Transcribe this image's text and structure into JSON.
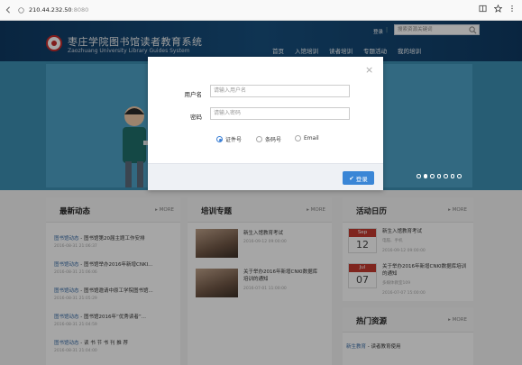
{
  "browser": {
    "address_host": "210.44.232.50",
    "address_port": ":8080"
  },
  "site": {
    "title": "枣庄学院图书馆读者教育系统",
    "subtitle": "Zaozhuang University Library Guides System",
    "login_link": "登录",
    "search_placeholder": "搜索资源关键词",
    "nav": [
      "首页",
      "入馆培训",
      "读者培训",
      "专题活动",
      "我的培训"
    ]
  },
  "modal": {
    "username_label": "用户名",
    "username_placeholder": "请输入用户名",
    "password_label": "密码",
    "password_placeholder": "请输入密码",
    "options": [
      {
        "label": "证件号",
        "checked": true
      },
      {
        "label": "条码号",
        "checked": false
      },
      {
        "label": "Email",
        "checked": false
      }
    ],
    "login_button": "登录"
  },
  "news": {
    "title": "最新动态",
    "more": "MORE",
    "items": [
      {
        "tag": "图书馆动态",
        "text": " - 图书馆第20届主题工作安排",
        "date": "2016-08-31 21:06:37"
      },
      {
        "tag": "图书馆动态",
        "text": " - 图书馆举办2016年新增CNKI...",
        "date": "2016-08-31 21:06:06"
      },
      {
        "tag": "图书馆动态",
        "text": " - 图书馆邀请中原工学院图书馆...",
        "date": "2016-08-31 21:05:29"
      },
      {
        "tag": "图书馆动态",
        "text": " - 图书馆2016年“优秀读者”...",
        "date": "2016-08-31 21:04:59"
      },
      {
        "tag": "图书馆动态",
        "text": " - 读 书 节 书 刊 推 荐",
        "date": "2016-08-31 21:04:00"
      }
    ]
  },
  "training": {
    "title": "培训专题",
    "more": "MORE",
    "items": [
      {
        "text": "新生入馆教育考试",
        "date": "2016-09-12 09:00:00"
      },
      {
        "text": "关于举办2016年新增CNKI数据库培训的通知",
        "date": "2016-07-01 11:00:00"
      }
    ]
  },
  "activities": {
    "title": "活动日历",
    "more": "MORE",
    "items": [
      {
        "month": "Sep",
        "day": "12",
        "title": "新生入馆教育考试",
        "sub": "电脑、手机",
        "date": "2016-09-12 09:00:00"
      },
      {
        "month": "Jul",
        "day": "07",
        "title": "关于举办2016年新增CNKI数据库培训的通知",
        "sub": "多媒体教室109",
        "date": "2016-07-07 15:00:00"
      }
    ]
  },
  "resources": {
    "title": "热门资源",
    "more": "MORE",
    "items": [
      {
        "tag": "新生教育",
        "text": " - 读者教育使用"
      }
    ]
  },
  "colors": {
    "header_bg": "#17507f",
    "accent_blue": "#3a86d6",
    "calendar_red": "#c33a2f",
    "banner": "#4da2c6"
  }
}
